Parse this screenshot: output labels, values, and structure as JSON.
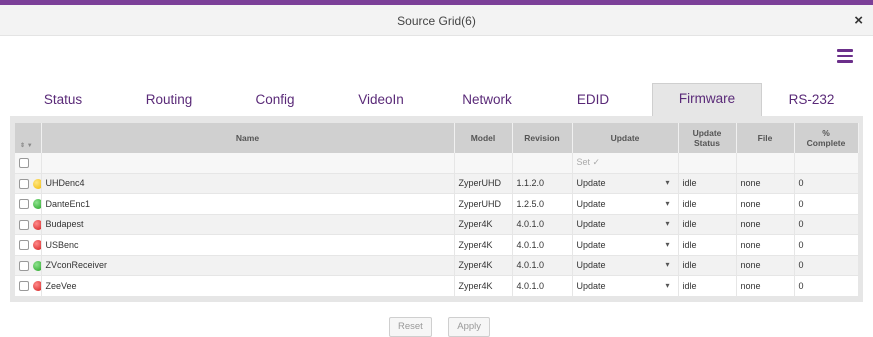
{
  "window": {
    "title": "Source Grid(6)",
    "close_symbol": "×"
  },
  "tabs": [
    "Status",
    "Routing",
    "Config",
    "VideoIn",
    "Network",
    "EDID",
    "Firmware",
    "RS-232"
  ],
  "active_tab": "Firmware",
  "columns": {
    "name": "Name",
    "model": "Model",
    "revision": "Revision",
    "update": "Update",
    "update_status_line1": "Update",
    "update_status_line2": "Status",
    "file": "File",
    "pct_line1": "%",
    "pct_line2": "Complete"
  },
  "filter_row": {
    "update_set": "Set ✓"
  },
  "rows": [
    {
      "status": "yellow",
      "name": "UHDenc4",
      "model": "ZyperUHD",
      "revision": "1.1.2.0",
      "update": "Update",
      "update_status": "idle",
      "file": "none",
      "complete": "0"
    },
    {
      "status": "green",
      "name": "DanteEnc1",
      "model": "ZyperUHD",
      "revision": "1.2.5.0",
      "update": "Update",
      "update_status": "idle",
      "file": "none",
      "complete": "0"
    },
    {
      "status": "red",
      "name": "Budapest",
      "model": "Zyper4K",
      "revision": "4.0.1.0",
      "update": "Update",
      "update_status": "idle",
      "file": "none",
      "complete": "0"
    },
    {
      "status": "red",
      "name": "USBenc",
      "model": "Zyper4K",
      "revision": "4.0.1.0",
      "update": "Update",
      "update_status": "idle",
      "file": "none",
      "complete": "0"
    },
    {
      "status": "green",
      "name": "ZVconReceiver",
      "model": "Zyper4K",
      "revision": "4.0.1.0",
      "update": "Update",
      "update_status": "idle",
      "file": "none",
      "complete": "0"
    },
    {
      "status": "red",
      "name": "ZeeVee",
      "model": "Zyper4K",
      "revision": "4.0.1.0",
      "update": "Update",
      "update_status": "idle",
      "file": "none",
      "complete": "0"
    }
  ],
  "buttons": {
    "reset": "Reset",
    "apply": "Apply"
  },
  "colors": {
    "accent": "#7b3f98",
    "tab_text": "#5a2a78",
    "header_bg": "#d0d0d0"
  }
}
